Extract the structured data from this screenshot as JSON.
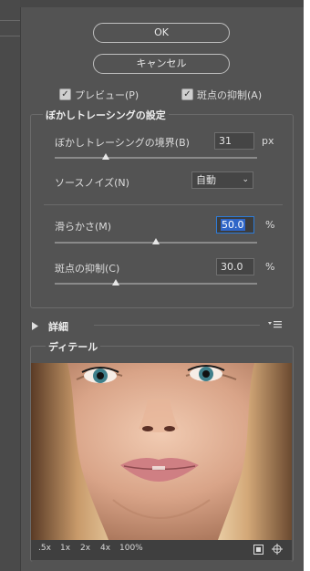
{
  "buttons": {
    "ok": "OK",
    "cancel": "キャンセル"
  },
  "options": {
    "preview_label": "プレビュー(P)",
    "preview_checked": true,
    "spot_label": "斑点の抑制(A)",
    "spot_checked": true
  },
  "tracing": {
    "title": "ぼかしトレーシングの設定",
    "border_label": "ぼかしトレーシングの境界(B)",
    "border_value": "31",
    "border_unit": "px",
    "border_level": 0.25,
    "noise_label": "ソースノイズ(N)",
    "noise_value": "自動",
    "smooth_label": "滑らかさ(M)",
    "smooth_value": "50.0",
    "smooth_unit": "%",
    "smooth_level": 0.5,
    "spot_label": "斑点の抑制(C)",
    "spot_value": "30.0",
    "spot_unit": "%",
    "spot_level": 0.3
  },
  "details": {
    "label": "詳細"
  },
  "detail": {
    "title": "ディテール",
    "zoom_levels": [
      ".5x",
      "1x",
      "2x",
      "4x",
      "100%"
    ]
  },
  "icons": {
    "expand": "triangle-right-icon",
    "panel_menu": "panel-menu-icon",
    "copy": "copy-layer-icon",
    "move": "move-icon"
  }
}
